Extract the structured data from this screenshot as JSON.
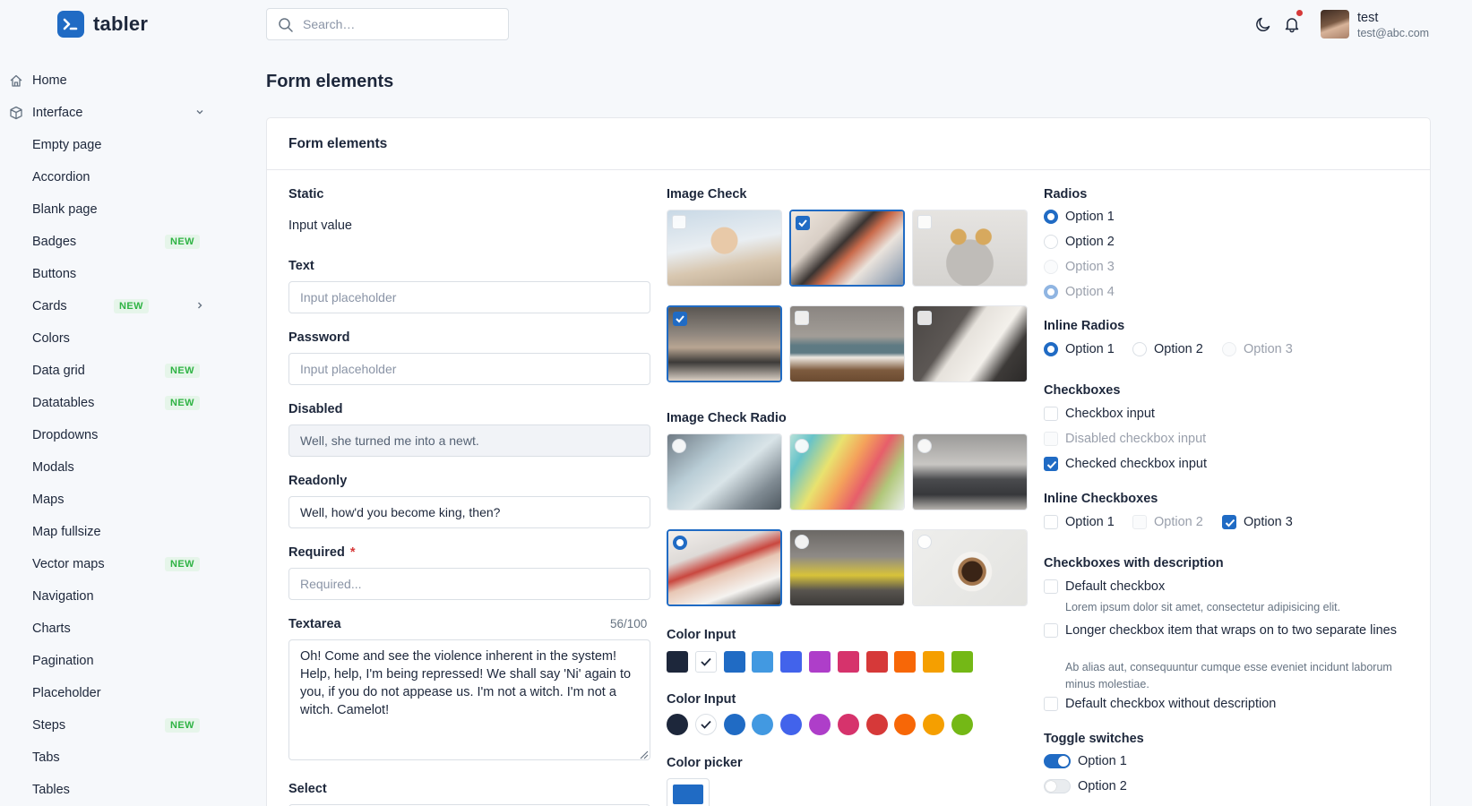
{
  "brand": {
    "name": "tabler"
  },
  "search": {
    "placeholder": "Search…"
  },
  "user": {
    "name": "test",
    "email": "test@abc.com"
  },
  "sidebar": {
    "items": [
      {
        "label": "Home",
        "icon": "home-icon"
      },
      {
        "label": "Interface",
        "icon": "cube-icon",
        "expanded": true
      },
      {
        "label": "Empty page"
      },
      {
        "label": "Accordion"
      },
      {
        "label": "Blank page"
      },
      {
        "label": "Badges",
        "badge": "NEW"
      },
      {
        "label": "Buttons"
      },
      {
        "label": "Cards",
        "badge": "NEW",
        "has_submenu": true
      },
      {
        "label": "Colors"
      },
      {
        "label": "Data grid",
        "badge": "NEW"
      },
      {
        "label": "Datatables",
        "badge": "NEW"
      },
      {
        "label": "Dropdowns"
      },
      {
        "label": "Modals"
      },
      {
        "label": "Maps"
      },
      {
        "label": "Map fullsize"
      },
      {
        "label": "Vector maps",
        "badge": "NEW"
      },
      {
        "label": "Navigation"
      },
      {
        "label": "Charts"
      },
      {
        "label": "Pagination"
      },
      {
        "label": "Placeholder"
      },
      {
        "label": "Steps",
        "badge": "NEW"
      },
      {
        "label": "Tabs"
      },
      {
        "label": "Tables"
      }
    ]
  },
  "page": {
    "title": "Form elements"
  },
  "card": {
    "title": "Form elements"
  },
  "form": {
    "static": {
      "label": "Static",
      "value": "Input value"
    },
    "text": {
      "label": "Text",
      "placeholder": "Input placeholder"
    },
    "password": {
      "label": "Password",
      "placeholder": "Input placeholder"
    },
    "disabled": {
      "label": "Disabled",
      "value": "Well, she turned me into a newt."
    },
    "readonly": {
      "label": "Readonly",
      "value": "Well, how'd you become king, then?"
    },
    "required": {
      "label": "Required",
      "star": "*",
      "placeholder": "Required..."
    },
    "textarea": {
      "label": "Textarea",
      "counter": "56/100",
      "value": "Oh! Come and see the violence inherent in the system! Help, help, I'm being repressed! We shall say 'Ni' again to you, if you do not appease us. I'm not a witch. I'm not a witch. Camelot!"
    },
    "select": {
      "label": "Select"
    }
  },
  "image_check": {
    "label": "Image Check",
    "tiles": [
      {
        "selected": false,
        "image": "woman-beach-photo"
      },
      {
        "selected": true,
        "image": "hand-drawing-photo"
      },
      {
        "selected": false,
        "image": "woman-glasses-photo"
      },
      {
        "selected": true,
        "image": "office-desk-photo"
      },
      {
        "selected": false,
        "image": "sofa-room-photo"
      },
      {
        "selected": false,
        "image": "laptop-notebook-photo"
      }
    ]
  },
  "image_check_radio": {
    "label": "Image Check Radio",
    "tiles": [
      {
        "selected": false,
        "image": "map-hands-photo"
      },
      {
        "selected": false,
        "image": "color-palette-photo"
      },
      {
        "selected": false,
        "image": "living-room-photo"
      },
      {
        "selected": true,
        "image": "typing-laptop-photo"
      },
      {
        "selected": false,
        "image": "child-laptop-photo"
      },
      {
        "selected": false,
        "image": "coffee-cup-photo"
      }
    ]
  },
  "color_input_square": {
    "label": "Color Input",
    "colors": [
      "#1d273b",
      "#ffffff",
      "#206bc4",
      "#4299e1",
      "#4263eb",
      "#ae3ec9",
      "#d6336c",
      "#d63939",
      "#f76707",
      "#f59f00",
      "#74b816"
    ],
    "selected_index": 1
  },
  "color_input_round": {
    "label": "Color Input",
    "colors": [
      "#1d273b",
      "#ffffff",
      "#206bc4",
      "#4299e1",
      "#4263eb",
      "#ae3ec9",
      "#d6336c",
      "#d63939",
      "#f76707",
      "#f59f00",
      "#74b816"
    ],
    "selected_index": 1
  },
  "color_picker": {
    "label": "Color picker",
    "value": "#206bc4"
  },
  "radios": {
    "label": "Radios",
    "options": [
      {
        "label": "Option 1",
        "state": "checked"
      },
      {
        "label": "Option 2",
        "state": "unchecked"
      },
      {
        "label": "Option 3",
        "state": "disabled"
      },
      {
        "label": "Option 4",
        "state": "checked-disabled"
      }
    ]
  },
  "inline_radios": {
    "label": "Inline Radios",
    "options": [
      {
        "label": "Option 1",
        "state": "checked"
      },
      {
        "label": "Option 2",
        "state": "unchecked"
      },
      {
        "label": "Option 3",
        "state": "disabled"
      }
    ]
  },
  "checkboxes": {
    "label": "Checkboxes",
    "options": [
      {
        "label": "Checkbox input",
        "state": "unchecked"
      },
      {
        "label": "Disabled checkbox input",
        "state": "disabled"
      },
      {
        "label": "Checked checkbox input",
        "state": "checked"
      }
    ]
  },
  "inline_checkboxes": {
    "label": "Inline Checkboxes",
    "options": [
      {
        "label": "Option 1",
        "state": "unchecked"
      },
      {
        "label": "Option 2",
        "state": "disabled"
      },
      {
        "label": "Option 3",
        "state": "checked"
      }
    ]
  },
  "checkboxes_desc": {
    "label": "Checkboxes with description",
    "items": [
      {
        "label": "Default checkbox",
        "description": "Lorem ipsum dolor sit amet, consectetur adipisicing elit."
      },
      {
        "label": "Longer checkbox item that wraps on to two separate lines",
        "description": "Ab alias aut, consequuntur cumque esse eveniet incidunt laborum minus molestiae."
      },
      {
        "label": "Default checkbox without description",
        "description": ""
      }
    ]
  },
  "toggles": {
    "label": "Toggle switches",
    "options": [
      {
        "label": "Option 1",
        "on": true
      },
      {
        "label": "Option 2",
        "on": false
      }
    ]
  }
}
